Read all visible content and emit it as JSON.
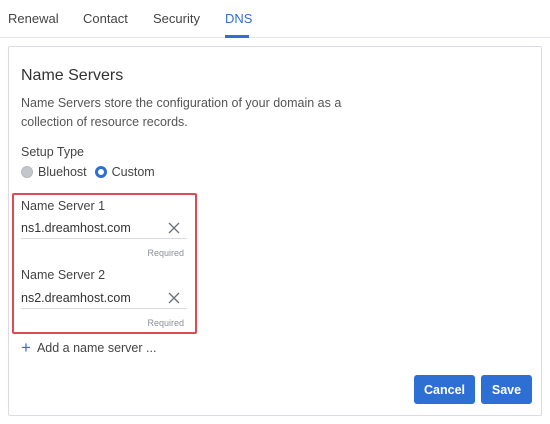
{
  "tabs": [
    {
      "label": "Renewal",
      "active": false
    },
    {
      "label": "Contact",
      "active": false
    },
    {
      "label": "Security",
      "active": false
    },
    {
      "label": "DNS",
      "active": true
    }
  ],
  "colors": {
    "accent": "#2e6fd6",
    "highlight": "#e04a52"
  },
  "card": {
    "title": "Name Servers",
    "description": "Name Servers store the configuration of your domain as a collection of resource records."
  },
  "setup": {
    "label": "Setup Type",
    "options": [
      {
        "label": "Bluehost",
        "selected": false
      },
      {
        "label": "Custom",
        "selected": true
      }
    ]
  },
  "name_servers": [
    {
      "label": "Name Server 1",
      "value": "ns1.dreamhost.com",
      "hint": "Required",
      "clear_icon": "close-icon"
    },
    {
      "label": "Name Server 2",
      "value": "ns2.dreamhost.com",
      "hint": "Required",
      "clear_icon": "close-icon"
    }
  ],
  "add_server": {
    "icon": "plus-icon",
    "label": "Add a name server ..."
  },
  "actions": {
    "cancel": "Cancel",
    "save": "Save"
  }
}
